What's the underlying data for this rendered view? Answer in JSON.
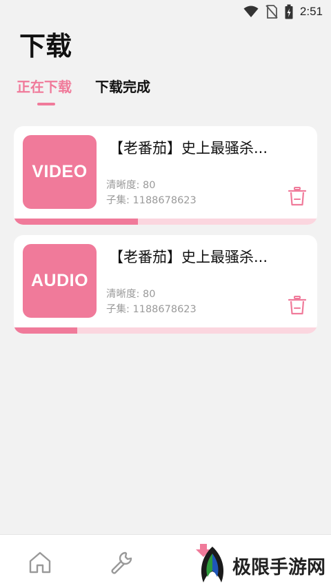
{
  "status_bar": {
    "time": "2:51",
    "icons": [
      "wifi-icon",
      "no-sim-icon",
      "battery-charging-icon"
    ]
  },
  "header": {
    "title": "下载"
  },
  "tabs": [
    {
      "label": "正在下载",
      "active": true
    },
    {
      "label": "下载完成",
      "active": false
    }
  ],
  "downloads": [
    {
      "thumb_label": "VIDEO",
      "title": "【老番茄】史上最骚杀...",
      "quality": "清晰度: 80",
      "episode": "子集: 1188678623",
      "progress": 0.41
    },
    {
      "thumb_label": "AUDIO",
      "title": "【老番茄】史上最骚杀...",
      "quality": "清晰度: 80",
      "episode": "子集: 1188678623",
      "progress": 0.21
    }
  ],
  "bottom_nav": [
    "home-icon",
    "wrench-icon",
    "download-icon"
  ],
  "watermark": {
    "text": "极限手游网"
  },
  "colors": {
    "accent": "#f07a9a",
    "progress_track": "#fbd6df",
    "background": "#f2f2f2"
  }
}
